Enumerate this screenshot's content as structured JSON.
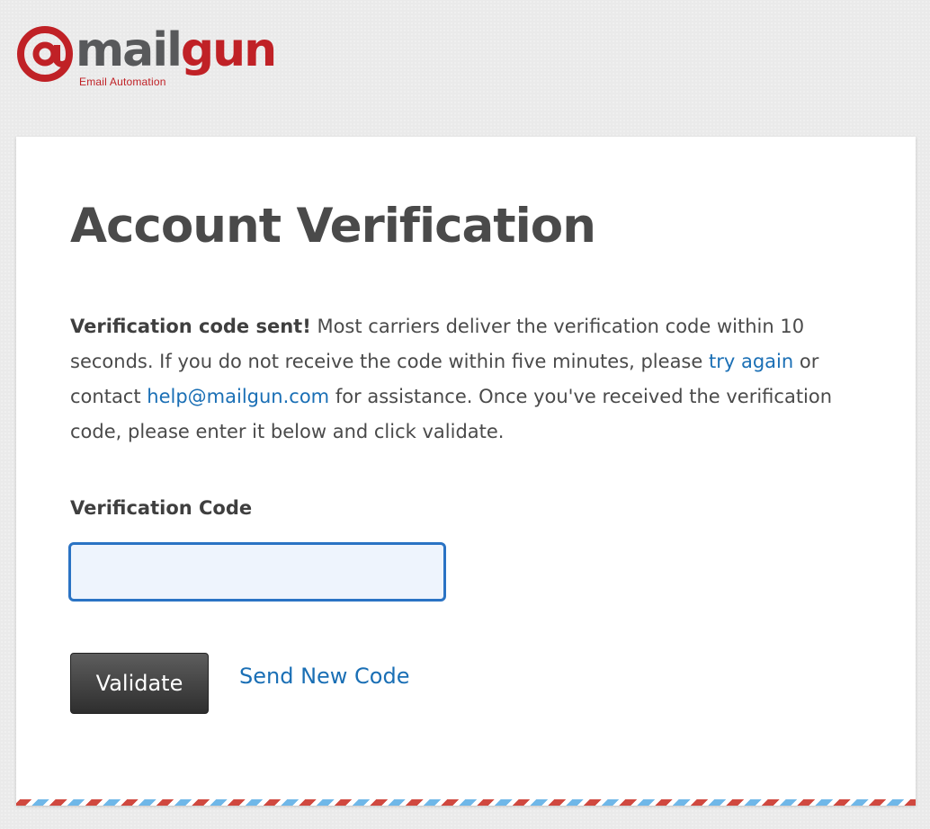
{
  "logo": {
    "word_part1": "mail",
    "word_part2": "gun",
    "tagline": "Email Automation",
    "icon": "at-sign-icon",
    "brand_red": "#c02126",
    "brand_gray": "#58595b"
  },
  "card": {
    "title": "Account Verification",
    "message": {
      "bold": "Verification code sent!",
      "part1": " Most carriers deliver the verification code within 10 seconds. If you do not receive the code within five minutes, please ",
      "try_again_link": "try again",
      "part2": " or contact ",
      "email_link": "help@mailgun.com",
      "part3": " for assistance. Once you've received the verification code, please enter it below and click validate."
    },
    "field_label": "Verification Code",
    "code_value": "",
    "validate_label": "Validate",
    "send_new_code_label": "Send New Code"
  },
  "colors": {
    "link": "#1a6fb5",
    "input_border": "#2a73c4",
    "stripe_red": "#d0483f",
    "stripe_blue": "#6fb7e8"
  }
}
